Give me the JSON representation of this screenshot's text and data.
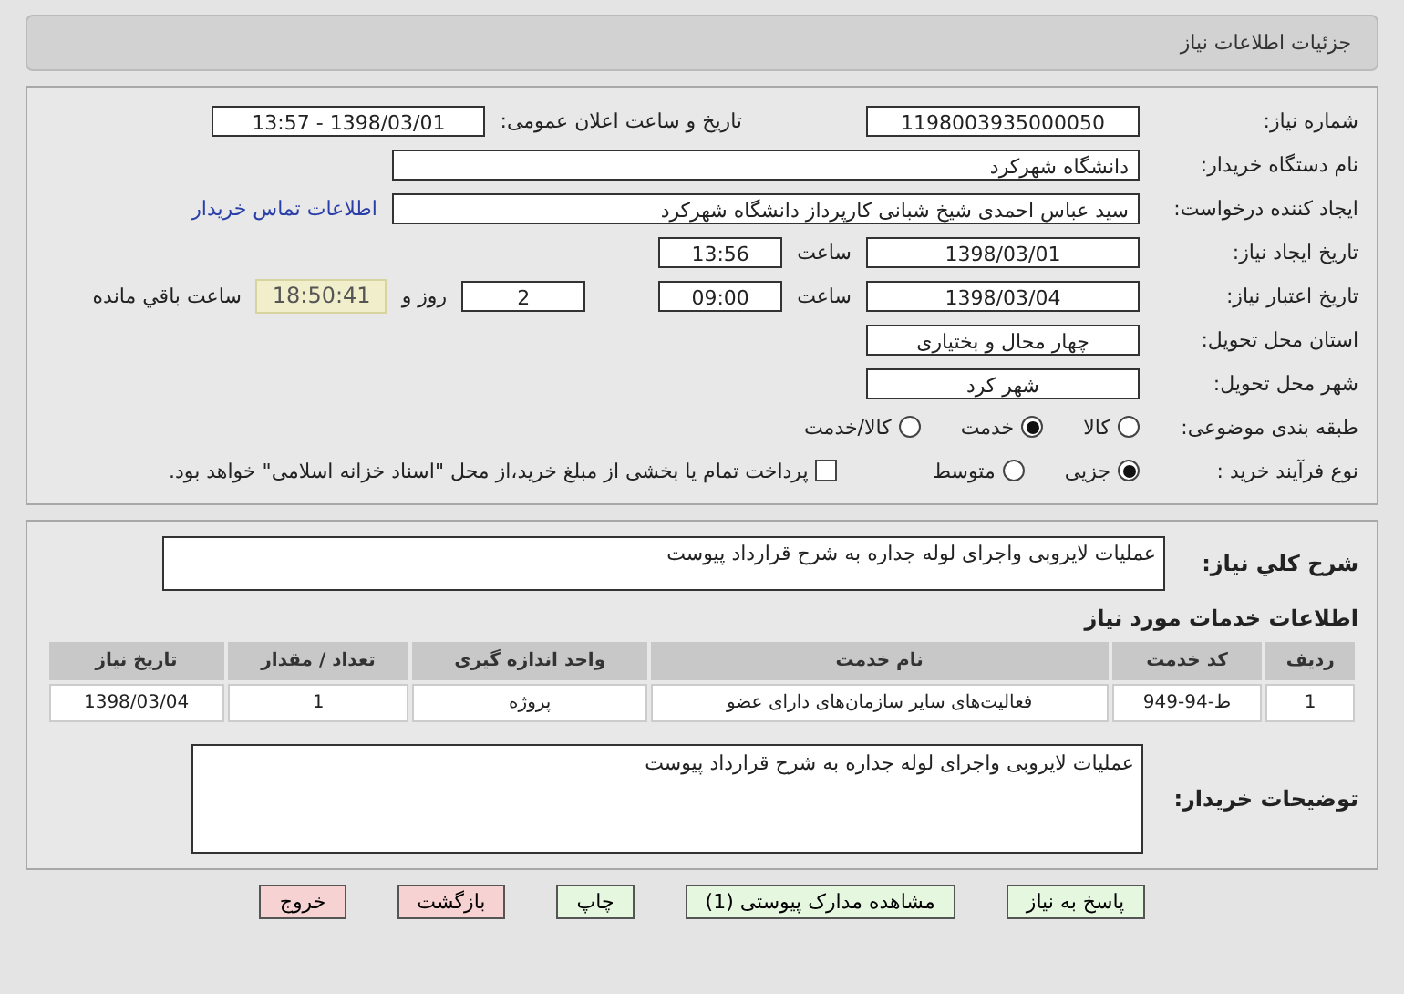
{
  "header": {
    "title": "جزئیات اطلاعات نیاز"
  },
  "details": {
    "rows": [
      {
        "items": [
          {
            "kind": "label",
            "text": "شماره نیاز:"
          },
          {
            "kind": "field",
            "value": "1198003935000050"
          },
          {
            "kind": "label",
            "text": "تاریخ و ساعت اعلان عمومی:"
          },
          {
            "kind": "field",
            "value": "1398/03/01 - 13:57"
          }
        ]
      },
      {
        "items": [
          {
            "kind": "label",
            "text": "نام دستگاه خریدار:"
          },
          {
            "kind": "wide_field",
            "value": "دانشگاه شهرکرد"
          }
        ]
      },
      {
        "items": [
          {
            "kind": "label",
            "text": "ایجاد کننده درخواست:"
          },
          {
            "kind": "wide_field",
            "value": "سید عباس احمدی شیخ شبانی کارپرداز دانشگاه شهرکرد"
          },
          {
            "kind": "link",
            "text": "اطلاعات تماس خریدار"
          }
        ]
      },
      {
        "items": [
          {
            "kind": "label",
            "text": "تاریخ ایجاد نیاز:"
          },
          {
            "kind": "field",
            "value": "1398/03/01"
          },
          {
            "kind": "text",
            "text": "ساعت"
          },
          {
            "kind": "short_field",
            "value": "13:56"
          }
        ]
      },
      {
        "items": [
          {
            "kind": "label",
            "text": "تاریخ اعتبار نیاز:"
          },
          {
            "kind": "field",
            "value": "1398/03/04"
          },
          {
            "kind": "text",
            "text": "ساعت"
          },
          {
            "kind": "short_field",
            "value": "09:00"
          },
          {
            "kind": "short_field",
            "value": "2"
          },
          {
            "kind": "text",
            "text": "روز و"
          },
          {
            "kind": "timer",
            "value": "18:50:41"
          },
          {
            "kind": "text",
            "text": "ساعت باقي مانده"
          }
        ]
      },
      {
        "items": [
          {
            "kind": "label",
            "text": "استان محل تحویل:"
          },
          {
            "kind": "field",
            "value": "چهار محال و بختیاری"
          }
        ]
      },
      {
        "items": [
          {
            "kind": "label",
            "text": "شهر محل تحویل:"
          },
          {
            "kind": "field",
            "value": "شهر کرد"
          }
        ]
      },
      {
        "items": [
          {
            "kind": "label",
            "text": "طبقه بندی موضوعی:"
          },
          {
            "kind": "radio",
            "text": "کالا",
            "selected": false
          },
          {
            "kind": "radio",
            "text": "خدمت",
            "selected": true
          },
          {
            "kind": "radio",
            "text": "کالا/خدمت",
            "selected": false
          }
        ]
      },
      {
        "items": [
          {
            "kind": "label",
            "text": "نوع فرآیند خرید :"
          },
          {
            "kind": "radio",
            "text": "جزیی",
            "selected": true
          },
          {
            "kind": "radio",
            "text": "متوسط",
            "selected": false
          },
          {
            "kind": "checkbox",
            "text": "پرداخت تمام یا بخشی از مبلغ خرید،از محل \"اسناد خزانه اسلامی\" خواهد بود.",
            "checked": false
          }
        ]
      }
    ]
  },
  "summary": {
    "label": "شرح کلي نياز:",
    "value": "عملیات لایروبی واجرای لوله جداره به شرح قرارداد پیوست"
  },
  "services": {
    "title": "اطلاعات خدمات مورد نیاز",
    "columns": [
      "ردیف",
      "کد خدمت",
      "نام خدمت",
      "واحد اندازه گیری",
      "تعداد / مقدار",
      "تاریخ نیاز"
    ],
    "rows": [
      [
        "1",
        "ط-94-949",
        "فعالیت‌های سایر سازمان‌های دارای عضو",
        "پروژه",
        "1",
        "1398/03/04"
      ]
    ]
  },
  "notes": {
    "label": "توضیحات خریدار:",
    "value": "عملیات لایروبی واجرای لوله جداره به شرح قرارداد پیوست"
  },
  "buttons": [
    {
      "label": "پاسخ به نیاز",
      "kind": "green"
    },
    {
      "label": "مشاهده مدارک پیوستی (1)",
      "kind": "green"
    },
    {
      "label": "چاپ",
      "kind": "green"
    },
    {
      "label": "بازگشت",
      "kind": "red"
    },
    {
      "label": "خروج",
      "kind": "red"
    }
  ]
}
